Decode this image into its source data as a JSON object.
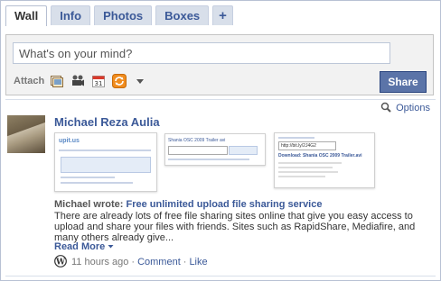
{
  "tabs": [
    {
      "label": "Wall"
    },
    {
      "label": "Info"
    },
    {
      "label": "Photos"
    },
    {
      "label": "Boxes"
    },
    {
      "label": "+"
    }
  ],
  "publisher": {
    "placeholder": "What's on your mind?",
    "attach_label": "Attach",
    "attach_icons": [
      "photo-icon",
      "video-icon",
      "event-icon",
      "link-icon",
      "more-chevron-icon"
    ],
    "share_label": "Share"
  },
  "options_label": "Options",
  "story": {
    "author": "Michael Reza Aulia",
    "wrote_prefix": "Michael wrote:",
    "link_title": "Free unlimited upload file sharing service",
    "body": "There are already lots of free file sharing sites online that give you easy access to upload and share your files with friends. Sites such as RapidShare, Mediafire, and many others already give...",
    "read_more": "Read More",
    "time": "11 hours ago",
    "comment": "Comment",
    "like": "Like",
    "separator": "·",
    "thumbs": {
      "t1_logo": "upit.us",
      "t2_text": "Shania OSC 2009 Trailer avi",
      "t3_url": "http://bit.ly/2J4G2",
      "t3_download": "Download: Shania OSC 2009 Trailer.avi"
    }
  },
  "colors": {
    "link": "#3b5998",
    "tab_bg": "#d8dfea",
    "share_bg": "#5b74a8"
  }
}
